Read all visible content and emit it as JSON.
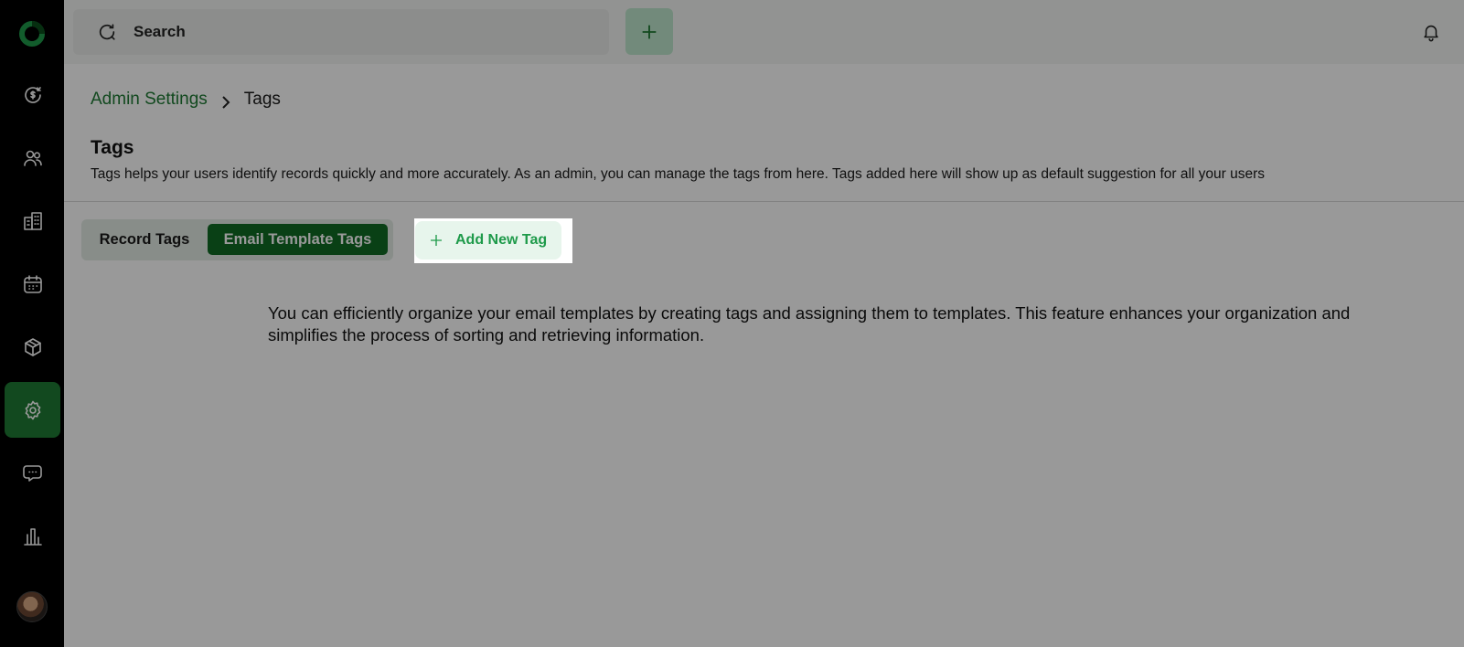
{
  "topbar": {
    "search_label": "Search",
    "search_icon": "search-refresh-icon",
    "add_icon": "plus-icon",
    "notification_icon": "bell-icon"
  },
  "sidebar": {
    "items": [
      {
        "name": "logo",
        "icon": "brand-logo"
      },
      {
        "name": "revenue",
        "icon": "dollar-cycle-icon"
      },
      {
        "name": "contacts",
        "icon": "users-icon"
      },
      {
        "name": "companies",
        "icon": "building-icon"
      },
      {
        "name": "calendar",
        "icon": "calendar-icon"
      },
      {
        "name": "products",
        "icon": "box-icon"
      },
      {
        "name": "settings",
        "icon": "gear-icon",
        "active": true
      },
      {
        "name": "messages",
        "icon": "chat-icon"
      },
      {
        "name": "reports",
        "icon": "bar-chart-icon"
      }
    ]
  },
  "breadcrumb": {
    "parent": "Admin Settings",
    "current": "Tags"
  },
  "page": {
    "title": "Tags",
    "description": "Tags helps your users identify records quickly and more accurately. As an admin, you can manage the tags from here. Tags added here will show up as default suggestion for all your users"
  },
  "tabs": {
    "record": "Record Tags",
    "email": "Email Template Tags",
    "active": "email"
  },
  "add_button": {
    "label": "Add New Tag"
  },
  "info_text": "You can efficiently organize your email templates by creating tags and assigning them to templates. This feature enhances your organization and simplifies the process of sorting and retrieving information.",
  "colors": {
    "brand_green": "#1e7a34",
    "active_tab": "#0f6b24",
    "accent_light": "#e7f5ec",
    "sidebar_bg": "#000000"
  }
}
